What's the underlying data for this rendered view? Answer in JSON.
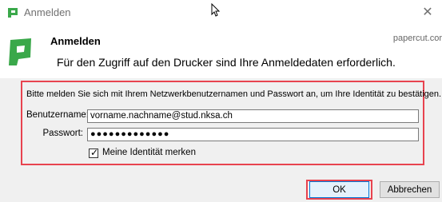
{
  "window": {
    "title": "Anmelden",
    "close_icon": "close-icon"
  },
  "header": {
    "title": "Anmelden",
    "message": "Für den Zugriff auf den Drucker sind Ihre Anmeldedaten erforderlich.",
    "brand": "papercut.cor"
  },
  "form": {
    "instructions": "Bitte melden Sie sich mit Ihrem Netzwerkbenutzernamen und Passwort an, um Ihre Identität zu bestätigen.",
    "username_label": "Benutzername:",
    "username_value": "vorname.nachname@stud.nksa.ch",
    "password_label": "Passwort:",
    "password_value": "●●●●●●●●●●●●●",
    "remember_label": "Meine Identität merken",
    "remember_checked": true
  },
  "buttons": {
    "ok": "OK",
    "cancel": "Abbrechen"
  },
  "colors": {
    "brand_green": "#3aa84a",
    "highlight_red": "#e8434f"
  }
}
